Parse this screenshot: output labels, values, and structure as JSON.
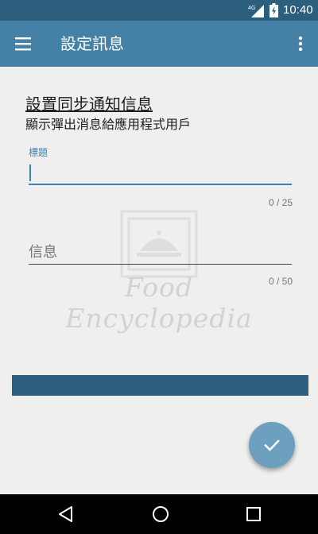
{
  "status_bar": {
    "network": "4G",
    "time": "10:40",
    "icons": [
      "signal-icon",
      "battery-icon"
    ]
  },
  "app_bar": {
    "title": "設定訊息",
    "icons": [
      "menu-icon",
      "more-vert-icon"
    ]
  },
  "form": {
    "heading": "設置同步通知信息",
    "subheading": "顯示彈出消息給應用程式用戶",
    "title_field": {
      "label": "標題",
      "value": "",
      "counter": "0 / 25"
    },
    "message_field": {
      "placeholder": "信息",
      "value": "",
      "counter": "0 / 50"
    }
  },
  "watermark": {
    "text": "Food Encyclopedia"
  },
  "fab": {
    "icon": "check-icon"
  },
  "nav_bar": {
    "icons": [
      "back-icon",
      "home-icon",
      "recents-icon"
    ]
  },
  "colors": {
    "status_bar": "#2c5f7e",
    "app_bar": "#4581a7",
    "accent": "#4581a7",
    "strip": "#2f5f7f",
    "fab": "#6d9fbf",
    "background": "#efefef"
  }
}
